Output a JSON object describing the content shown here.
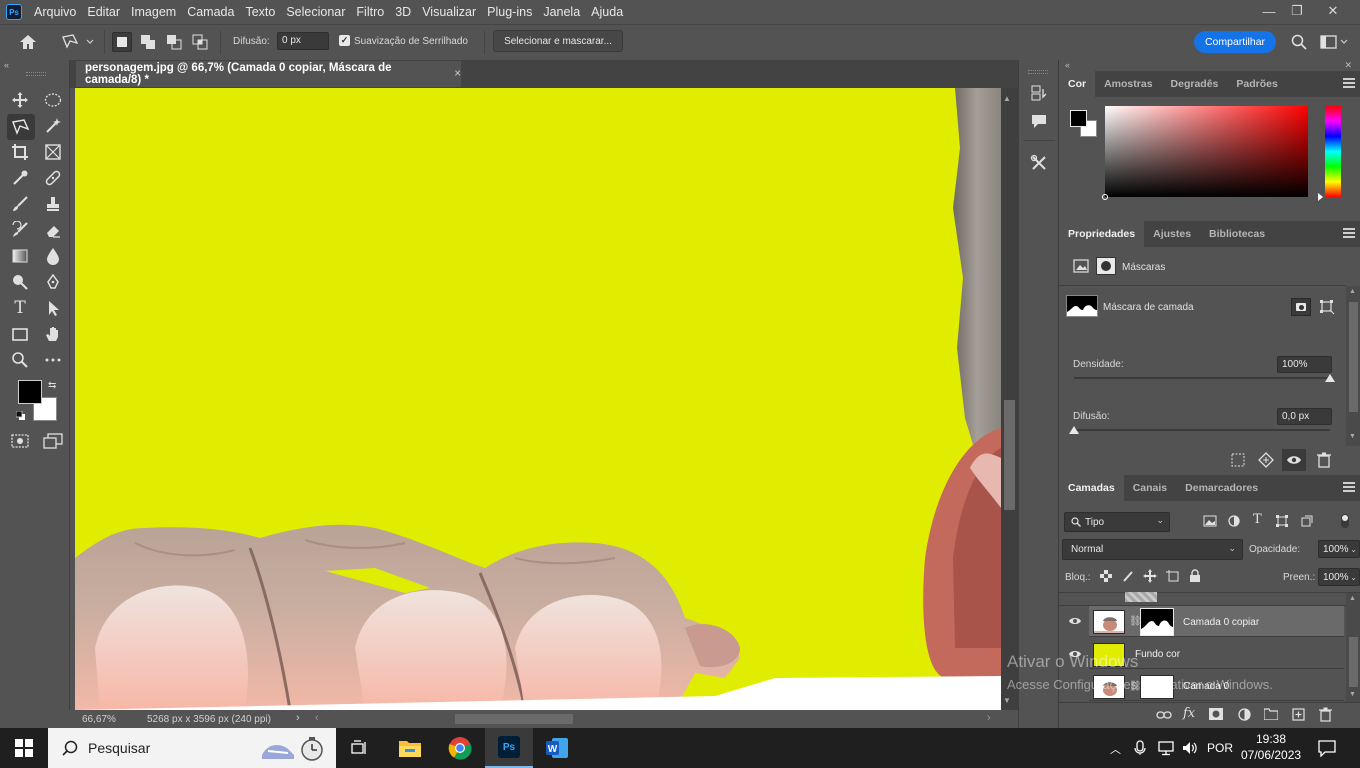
{
  "app": {
    "logo": "Ps",
    "menu": [
      "Arquivo",
      "Editar",
      "Imagem",
      "Camada",
      "Texto",
      "Selecionar",
      "Filtro",
      "3D",
      "Visualizar",
      "Plug-ins",
      "Janela",
      "Ajuda"
    ],
    "window_controls": [
      "—",
      "❐",
      "✕"
    ]
  },
  "options_bar": {
    "feather_label": "Difusão:",
    "feather_value": "0 px",
    "antialias_label": "Suavização de Serrilhado",
    "antialias_checked": true,
    "select_mask_button": "Selecionar e mascarar...",
    "share_button": "Compartilhar"
  },
  "document": {
    "tab_title": "personagem.jpg @ 66,7% (Camada 0 copiar, Máscara de camada/8) *",
    "close": "×",
    "background_color": "#e0ed00",
    "zoom": "66,67%",
    "dimensions": "5268 px x 3596 px (240 ppi)"
  },
  "color_panel": {
    "tabs": [
      "Cor",
      "Amostras",
      "Degradês",
      "Padrões"
    ],
    "active_tab": "Cor",
    "foreground": "#000000",
    "background": "#ffffff"
  },
  "properties_panel": {
    "tabs": [
      "Propriedades",
      "Ajustes",
      "Bibliotecas"
    ],
    "active_tab": "Propriedades",
    "section": "Máscaras",
    "mask_label": "Máscara de camada",
    "density_label": "Densidade:",
    "density_value": "100%",
    "feather_label": "Difusão:",
    "feather_value": "0,0 px"
  },
  "layers_panel": {
    "tabs": [
      "Camadas",
      "Canais",
      "Demarcadores"
    ],
    "active_tab": "Camadas",
    "filter_kind": "Tipo",
    "blend_mode": "Normal",
    "opacity_label": "Opacidade:",
    "opacity_value": "100%",
    "lock_label": "Bloq.:",
    "fill_label": "Preen.:",
    "fill_value": "100%",
    "layers": [
      {
        "name": "Camada 0 copiar",
        "visible": true,
        "selected": true,
        "has_mask": true
      },
      {
        "name": "Fundo cor",
        "visible": true,
        "selected": false,
        "has_mask": false,
        "color": "#e0ed00"
      },
      {
        "name": "Camada 0",
        "visible": false,
        "selected": false,
        "has_mask": true
      }
    ]
  },
  "watermark": {
    "line1": "Ativar o Windows",
    "line2": "Acesse Configurações para ativar o Windows."
  },
  "taskbar": {
    "search_placeholder": "Pesquisar",
    "language": "POR",
    "time": "19:38",
    "date": "07/06/2023"
  }
}
